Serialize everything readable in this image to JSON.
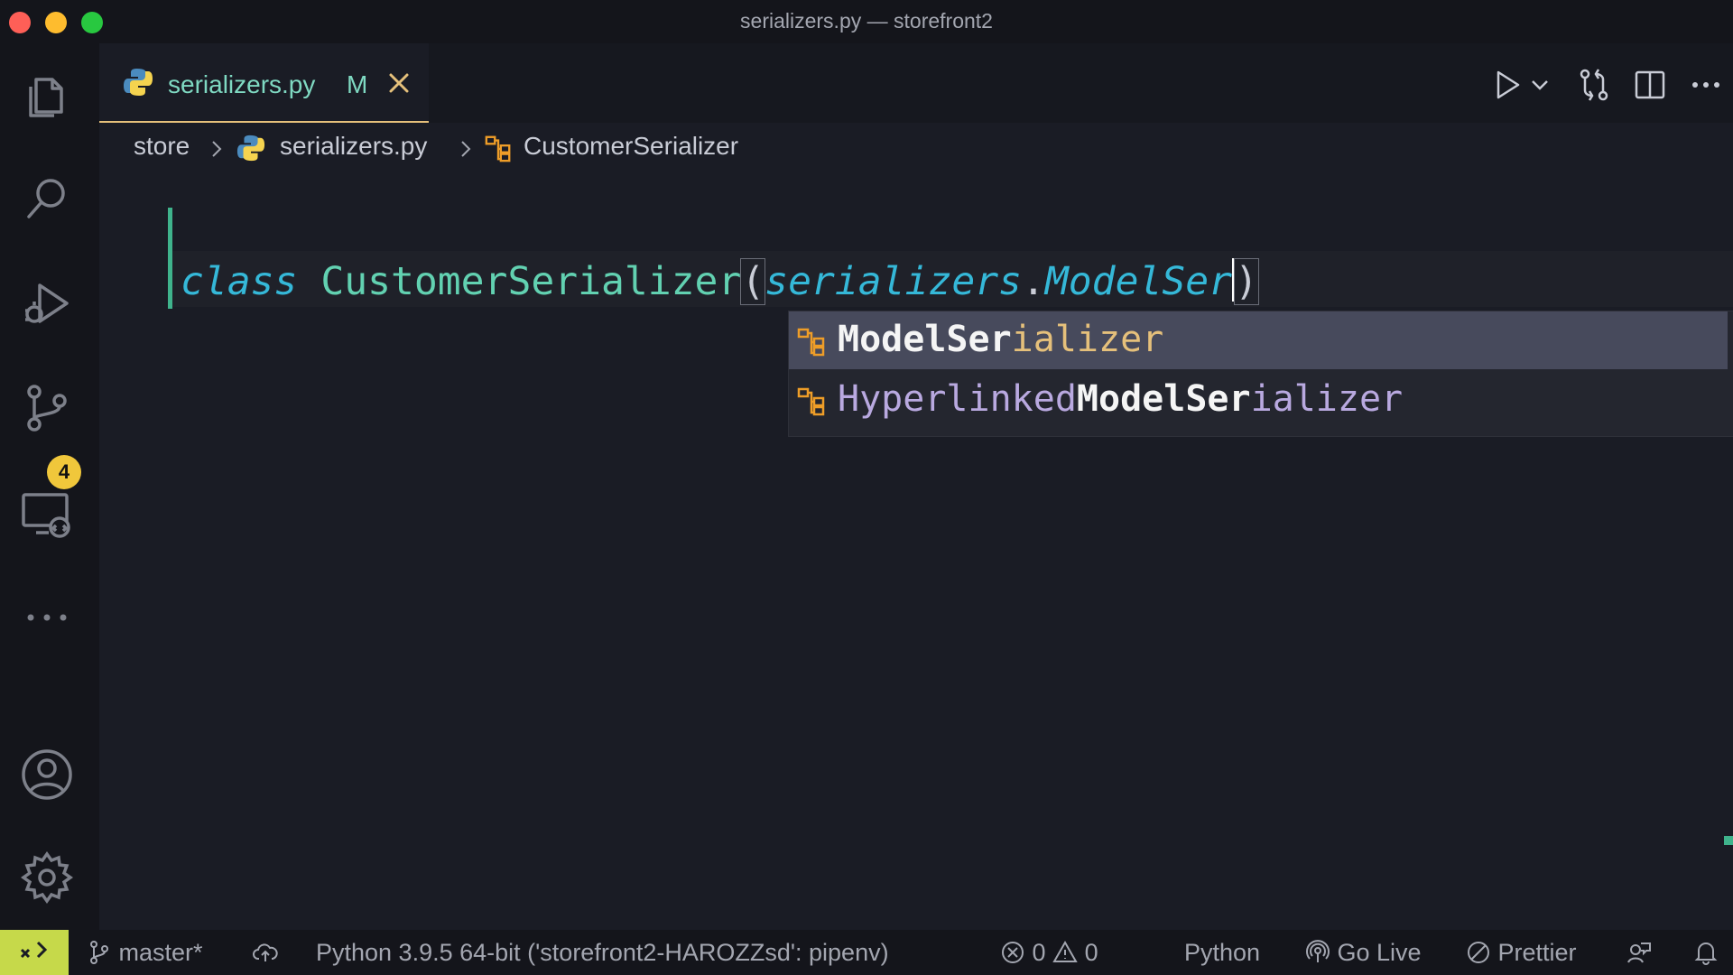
{
  "window": {
    "title": "serializers.py — storefront2"
  },
  "activity_bar": {
    "items": [
      {
        "name": "explorer",
        "icon": "files-icon"
      },
      {
        "name": "search",
        "icon": "search-icon"
      },
      {
        "name": "run-and-debug",
        "icon": "debug-icon"
      },
      {
        "name": "source-control",
        "icon": "source-control-icon",
        "badge": "4"
      },
      {
        "name": "remote-explorer",
        "icon": "remote-explorer-icon"
      },
      {
        "name": "more",
        "icon": "ellipsis-icon"
      },
      {
        "name": "accounts",
        "icon": "account-icon"
      },
      {
        "name": "manage",
        "icon": "gear-icon"
      }
    ]
  },
  "tab": {
    "filename": "serializers.py",
    "status": "M"
  },
  "breadcrumb": {
    "folder": "store",
    "file": "serializers.py",
    "symbol": "CustomerSerializer"
  },
  "editor": {
    "keyword": "class",
    "class_name": "CustomerSerializer",
    "open_paren": "(",
    "module": "serializers",
    "dot": ".",
    "typed": "ModelSer",
    "close_paren": ")"
  },
  "suggestions": [
    {
      "before": "",
      "match": "ModelSer",
      "after": "ializer",
      "selected": true
    },
    {
      "before": "Hyperlinked",
      "match": "ModelSer",
      "after": "ializer",
      "selected": false
    }
  ],
  "status_bar": {
    "branch": "master*",
    "interpreter": "Python 3.9.5 64-bit ('storefront2-HAROZZsd': pipenv)",
    "errors": "0",
    "warnings": "0",
    "language": "Python",
    "go_live": "Go Live",
    "prettier": "Prettier"
  },
  "colors": {
    "background": "#1a1c25",
    "accent_tab": "#e5c07b",
    "keyword": "#35b8d8",
    "class": "#62d1b1",
    "badge": "#f0c73b",
    "remote": "#c6d94a"
  }
}
